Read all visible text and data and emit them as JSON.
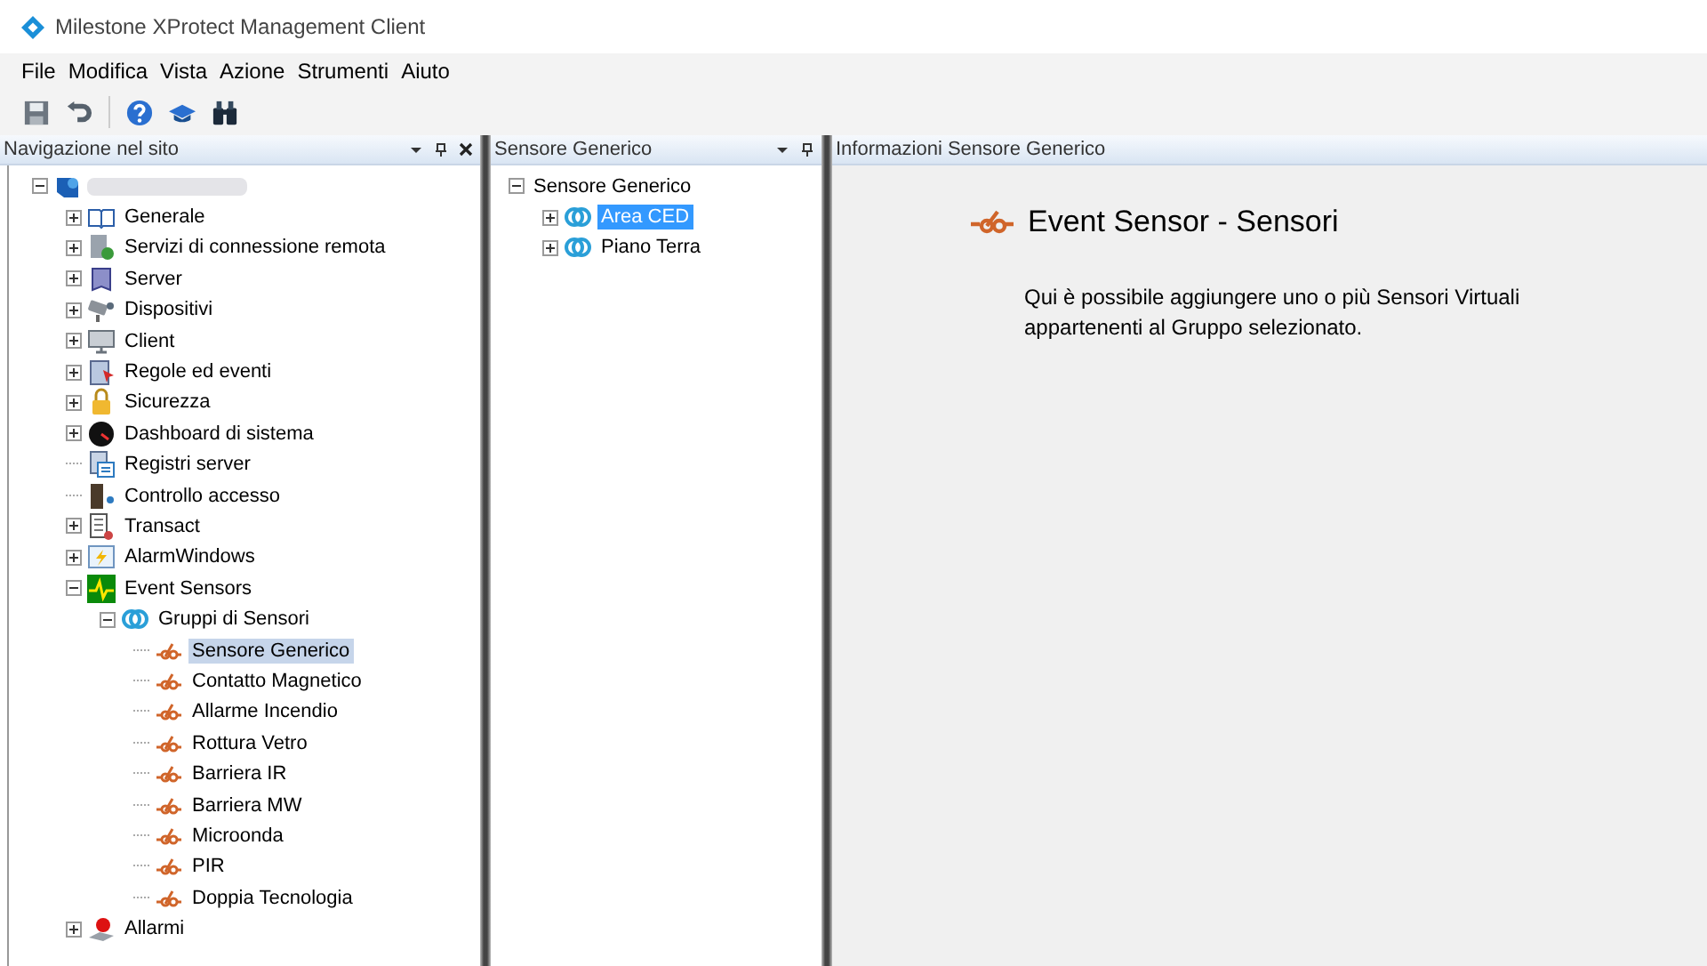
{
  "window": {
    "title": "Milestone XProtect Management Client"
  },
  "menu": [
    "File",
    "Modifica",
    "Vista",
    "Azione",
    "Strumenti",
    "Aiuto"
  ],
  "navigation": {
    "title": "Navigazione nel sito",
    "tree": [
      {
        "kind": "root",
        "expanded": true,
        "selected": false,
        "children": [
          {
            "label": "Generale",
            "kind": "book",
            "expanded": false,
            "selected": false
          },
          {
            "label": "Servizi di connessione remota",
            "kind": "remote",
            "expanded": false,
            "selected": false
          },
          {
            "label": "Server",
            "kind": "server",
            "expanded": false,
            "selected": false
          },
          {
            "label": "Dispositivi",
            "kind": "camera",
            "expanded": false,
            "selected": false
          },
          {
            "label": "Client",
            "kind": "monitor",
            "expanded": false,
            "selected": false
          },
          {
            "label": "Regole ed eventi",
            "kind": "rules",
            "expanded": false,
            "selected": false
          },
          {
            "label": "Sicurezza",
            "kind": "lock",
            "expanded": false,
            "selected": false
          },
          {
            "label": "Dashboard di sistema",
            "kind": "gauge",
            "expanded": false,
            "selected": false
          },
          {
            "label": "Registri server",
            "kind": "log",
            "selected": false
          },
          {
            "label": "Controllo accesso",
            "kind": "door",
            "selected": false
          },
          {
            "label": "Transact",
            "kind": "receipt",
            "expanded": false,
            "selected": false
          },
          {
            "label": "AlarmWindows",
            "kind": "alarmwin",
            "expanded": false,
            "selected": false
          },
          {
            "label": "Event Sensors",
            "kind": "pulse",
            "expanded": true,
            "selected": false,
            "children": [
              {
                "label": "Gruppi di Sensori",
                "kind": "rings",
                "expanded": true,
                "selected": false,
                "children": [
                  {
                    "label": "Sensore Generico",
                    "kind": "sensor",
                    "selected": true
                  },
                  {
                    "label": "Contatto Magnetico",
                    "kind": "sensor",
                    "selected": false
                  },
                  {
                    "label": "Allarme Incendio",
                    "kind": "sensor",
                    "selected": false
                  },
                  {
                    "label": "Rottura Vetro",
                    "kind": "sensor",
                    "selected": false
                  },
                  {
                    "label": "Barriera IR",
                    "kind": "sensor",
                    "selected": false
                  },
                  {
                    "label": "Barriera MW",
                    "kind": "sensor",
                    "selected": false
                  },
                  {
                    "label": "Microonda",
                    "kind": "sensor",
                    "selected": false
                  },
                  {
                    "label": "PIR",
                    "kind": "sensor",
                    "selected": false
                  },
                  {
                    "label": "Doppia Tecnologia",
                    "kind": "sensor",
                    "selected": false
                  }
                ]
              }
            ]
          },
          {
            "label": "Allarmi",
            "kind": "alarm",
            "expanded": false,
            "selected": false
          }
        ]
      }
    ]
  },
  "overview": {
    "title": "Sensore Generico",
    "tree": [
      {
        "label": "Sensore Generico",
        "expanded": true,
        "selected": false,
        "children": [
          {
            "label": "Area CED",
            "kind": "rings",
            "expanded": false,
            "selected": true
          },
          {
            "label": "Piano Terra",
            "kind": "rings",
            "expanded": false,
            "selected": false
          }
        ]
      }
    ]
  },
  "properties": {
    "title": "Informazioni Sensore Generico",
    "heading": "Event Sensor - Sensori",
    "description": "Qui è possibile aggiungere uno o più Sensori Virtuali appartenenti al Gruppo selezionato."
  }
}
